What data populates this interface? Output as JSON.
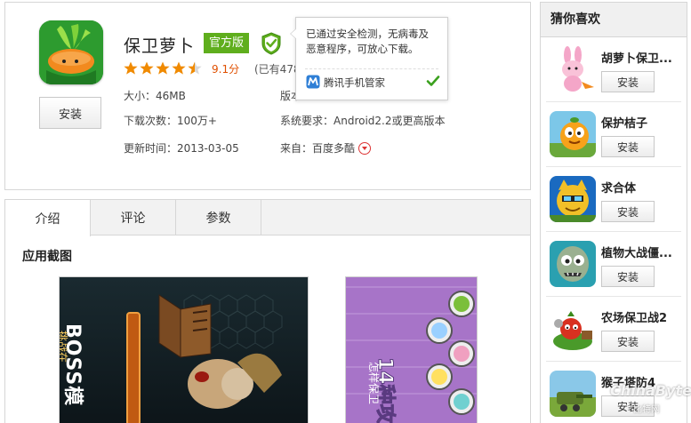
{
  "app": {
    "title": "保卫萝卜",
    "official_badge": "官方版",
    "rating_stars": 4.5,
    "score": "9.1分",
    "rated_count": "(已有478",
    "install_label": "安装",
    "size_label": "大小：",
    "size_value": "46MB",
    "version_label": "版本",
    "downloads_label": "下载次数：",
    "downloads_value": "100万+",
    "sysreq_label": "系统要求：",
    "sysreq_value": "Android2.2或更高版本",
    "updated_label": "更新时间：",
    "updated_value": "2013-03-05",
    "source_label": "来自：",
    "source_value": "百度多酷"
  },
  "tooltip": {
    "line1": "已通过安全检测，无病毒及",
    "line2": "恶意程序，可放心下载。",
    "footer": "腾讯手机管家"
  },
  "tabs": [
    {
      "label": "介绍"
    },
    {
      "label": "评论"
    },
    {
      "label": "参数"
    }
  ],
  "section_title": "应用截图",
  "screenshots": {
    "shot1_text": "BOSS模",
    "shot1_sub": "挑战在",
    "shot2_text": "14种攻",
    "shot2_sub": "怎样保卫"
  },
  "sidebar": {
    "title": "猜你喜欢",
    "items": [
      {
        "name": "胡萝卜保卫...",
        "button": "安装"
      },
      {
        "name": "保护桔子",
        "button": "安装"
      },
      {
        "name": "求合体",
        "button": "安装"
      },
      {
        "name": "植物大战僵...",
        "button": "安装"
      },
      {
        "name": "农场保卫战2",
        "button": "安装"
      },
      {
        "name": "猴子塔防4",
        "button": "安装"
      }
    ]
  },
  "watermark": {
    "main": "ChinaByte",
    "sub": "比特网"
  },
  "colors": {
    "accent_green": "#5fae1d",
    "score_orange": "#e05000",
    "star": "#f08a00"
  }
}
